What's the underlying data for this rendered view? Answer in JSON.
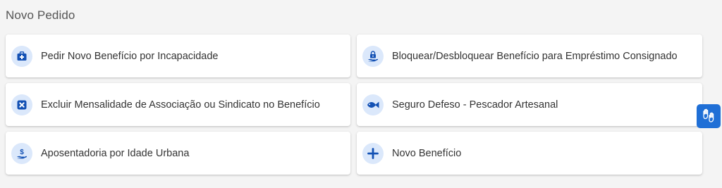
{
  "section": {
    "title": "Novo Pedido"
  },
  "cards": [
    {
      "label": "Pedir Novo Benefício por Incapacidade",
      "icon": "medical-kit-icon"
    },
    {
      "label": "Bloquear/Desbloquear Benefício para Empréstimo Consignado",
      "icon": "hand-lock-icon"
    },
    {
      "label": "Excluir Mensalidade de Associação ou Sindicato no Benefício",
      "icon": "close-square-icon"
    },
    {
      "label": "Seguro Defeso - Pescador Artesanal",
      "icon": "fish-icon"
    },
    {
      "label": "Aposentadoria por Idade Urbana",
      "icon": "hand-money-icon"
    },
    {
      "label": "Novo Benefício",
      "icon": "plus-icon"
    }
  ],
  "colors": {
    "icon_blue": "#1351b4",
    "icon_bg": "#dbe8fb",
    "accessibility_button": "#1f6fd6"
  },
  "accessibility_button": {
    "icon": "sign-language-hands-icon"
  }
}
